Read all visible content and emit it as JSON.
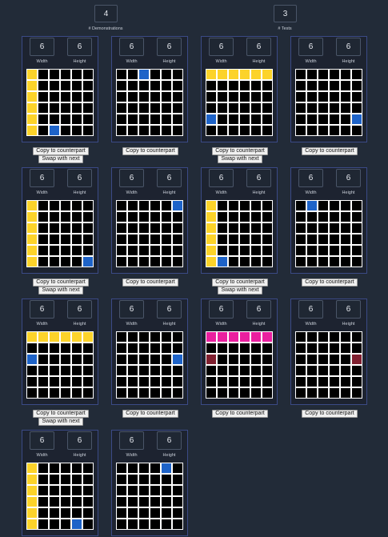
{
  "header": {
    "demonstrations": {
      "value": "4",
      "label": "# Demonstrations"
    },
    "tests": {
      "value": "3",
      "label": "# Tests"
    }
  },
  "colors": {
    "0": "#000000",
    "1": "#1e63c8",
    "3": "#7f1f2f",
    "4": "#fcd32a",
    "6": "#ea1f9f"
  },
  "buttons": {
    "copy_label": "Copy to counterpart",
    "swap_label": "Swap with next"
  },
  "rows": [
    [
      {
        "width": "6",
        "height": "6",
        "width_label": "Width",
        "height_label": "Height",
        "grid": [
          [
            4,
            0,
            0,
            0,
            0,
            0
          ],
          [
            4,
            0,
            0,
            0,
            0,
            0
          ],
          [
            4,
            0,
            0,
            0,
            0,
            0
          ],
          [
            4,
            0,
            0,
            0,
            0,
            0
          ],
          [
            4,
            0,
            0,
            0,
            0,
            0
          ],
          [
            4,
            0,
            1,
            0,
            0,
            0
          ]
        ]
      },
      {
        "width": "6",
        "height": "6",
        "width_label": "Width",
        "height_label": "Height",
        "grid": [
          [
            0,
            0,
            1,
            0,
            0,
            0
          ],
          [
            0,
            0,
            0,
            0,
            0,
            0
          ],
          [
            0,
            0,
            0,
            0,
            0,
            0
          ],
          [
            0,
            0,
            0,
            0,
            0,
            0
          ],
          [
            0,
            0,
            0,
            0,
            0,
            0
          ],
          [
            0,
            0,
            0,
            0,
            0,
            0
          ]
        ]
      },
      {
        "width": "6",
        "height": "6",
        "width_label": "Width",
        "height_label": "Height",
        "grid": [
          [
            4,
            4,
            4,
            4,
            4,
            4
          ],
          [
            0,
            0,
            0,
            0,
            0,
            0
          ],
          [
            0,
            0,
            0,
            0,
            0,
            0
          ],
          [
            0,
            0,
            0,
            0,
            0,
            0
          ],
          [
            1,
            0,
            0,
            0,
            0,
            0
          ],
          [
            0,
            0,
            0,
            0,
            0,
            0
          ]
        ]
      },
      {
        "width": "6",
        "height": "6",
        "width_label": "Width",
        "height_label": "Height",
        "grid": [
          [
            0,
            0,
            0,
            0,
            0,
            0
          ],
          [
            0,
            0,
            0,
            0,
            0,
            0
          ],
          [
            0,
            0,
            0,
            0,
            0,
            0
          ],
          [
            0,
            0,
            0,
            0,
            0,
            0
          ],
          [
            0,
            0,
            0,
            0,
            0,
            1
          ],
          [
            0,
            0,
            0,
            0,
            0,
            0
          ]
        ]
      }
    ],
    [
      {
        "width": "6",
        "height": "6",
        "width_label": "Width",
        "height_label": "Height",
        "grid": [
          [
            4,
            0,
            0,
            0,
            0,
            0
          ],
          [
            4,
            0,
            0,
            0,
            0,
            0
          ],
          [
            4,
            0,
            0,
            0,
            0,
            0
          ],
          [
            4,
            0,
            0,
            0,
            0,
            0
          ],
          [
            4,
            0,
            0,
            0,
            0,
            0
          ],
          [
            4,
            0,
            0,
            0,
            0,
            1
          ]
        ]
      },
      {
        "width": "6",
        "height": "6",
        "width_label": "Width",
        "height_label": "Height",
        "grid": [
          [
            0,
            0,
            0,
            0,
            0,
            1
          ],
          [
            0,
            0,
            0,
            0,
            0,
            0
          ],
          [
            0,
            0,
            0,
            0,
            0,
            0
          ],
          [
            0,
            0,
            0,
            0,
            0,
            0
          ],
          [
            0,
            0,
            0,
            0,
            0,
            0
          ],
          [
            0,
            0,
            0,
            0,
            0,
            0
          ]
        ]
      },
      {
        "width": "6",
        "height": "6",
        "width_label": "Width",
        "height_label": "Height",
        "grid": [
          [
            4,
            0,
            0,
            0,
            0,
            0
          ],
          [
            4,
            0,
            0,
            0,
            0,
            0
          ],
          [
            4,
            0,
            0,
            0,
            0,
            0
          ],
          [
            4,
            0,
            0,
            0,
            0,
            0
          ],
          [
            4,
            0,
            0,
            0,
            0,
            0
          ],
          [
            4,
            1,
            0,
            0,
            0,
            0
          ]
        ]
      },
      {
        "width": "6",
        "height": "6",
        "width_label": "Width",
        "height_label": "Height",
        "grid": [
          [
            0,
            1,
            0,
            0,
            0,
            0
          ],
          [
            0,
            0,
            0,
            0,
            0,
            0
          ],
          [
            0,
            0,
            0,
            0,
            0,
            0
          ],
          [
            0,
            0,
            0,
            0,
            0,
            0
          ],
          [
            0,
            0,
            0,
            0,
            0,
            0
          ],
          [
            0,
            0,
            0,
            0,
            0,
            0
          ]
        ]
      }
    ],
    [
      {
        "width": "6",
        "height": "6",
        "width_label": "Width",
        "height_label": "Height",
        "grid": [
          [
            4,
            4,
            4,
            4,
            4,
            4
          ],
          [
            0,
            0,
            0,
            0,
            0,
            0
          ],
          [
            1,
            0,
            0,
            0,
            0,
            0
          ],
          [
            0,
            0,
            0,
            0,
            0,
            0
          ],
          [
            0,
            0,
            0,
            0,
            0,
            0
          ],
          [
            0,
            0,
            0,
            0,
            0,
            0
          ]
        ]
      },
      {
        "width": "6",
        "height": "6",
        "width_label": "Width",
        "height_label": "Height",
        "grid": [
          [
            0,
            0,
            0,
            0,
            0,
            0
          ],
          [
            0,
            0,
            0,
            0,
            0,
            0
          ],
          [
            0,
            0,
            0,
            0,
            0,
            1
          ],
          [
            0,
            0,
            0,
            0,
            0,
            0
          ],
          [
            0,
            0,
            0,
            0,
            0,
            0
          ],
          [
            0,
            0,
            0,
            0,
            0,
            0
          ]
        ]
      },
      {
        "width": "6",
        "height": "6",
        "width_label": "Width",
        "height_label": "Height",
        "grid": [
          [
            6,
            6,
            6,
            6,
            6,
            6
          ],
          [
            0,
            0,
            0,
            0,
            0,
            0
          ],
          [
            3,
            0,
            0,
            0,
            0,
            0
          ],
          [
            0,
            0,
            0,
            0,
            0,
            0
          ],
          [
            0,
            0,
            0,
            0,
            0,
            0
          ],
          [
            0,
            0,
            0,
            0,
            0,
            0
          ]
        ]
      },
      {
        "width": "6",
        "height": "6",
        "width_label": "Width",
        "height_label": "Height",
        "grid": [
          [
            0,
            0,
            0,
            0,
            0,
            0
          ],
          [
            0,
            0,
            0,
            0,
            0,
            0
          ],
          [
            0,
            0,
            0,
            0,
            0,
            3
          ],
          [
            0,
            0,
            0,
            0,
            0,
            0
          ],
          [
            0,
            0,
            0,
            0,
            0,
            0
          ],
          [
            0,
            0,
            0,
            0,
            0,
            0
          ]
        ]
      }
    ],
    [
      {
        "width": "6",
        "height": "6",
        "width_label": "Width",
        "height_label": "Height",
        "grid": [
          [
            4,
            0,
            0,
            0,
            0,
            0
          ],
          [
            4,
            0,
            0,
            0,
            0,
            0
          ],
          [
            4,
            0,
            0,
            0,
            0,
            0
          ],
          [
            4,
            0,
            0,
            0,
            0,
            0
          ],
          [
            4,
            0,
            0,
            0,
            0,
            0
          ],
          [
            4,
            0,
            0,
            0,
            1,
            0
          ]
        ]
      },
      {
        "width": "6",
        "height": "6",
        "width_label": "Width",
        "height_label": "Height",
        "grid": [
          [
            0,
            0,
            0,
            0,
            1,
            0
          ],
          [
            0,
            0,
            0,
            0,
            0,
            0
          ],
          [
            0,
            0,
            0,
            0,
            0,
            0
          ],
          [
            0,
            0,
            0,
            0,
            0,
            0
          ],
          [
            0,
            0,
            0,
            0,
            0,
            0
          ],
          [
            0,
            0,
            0,
            0,
            0,
            0
          ]
        ]
      }
    ]
  ]
}
